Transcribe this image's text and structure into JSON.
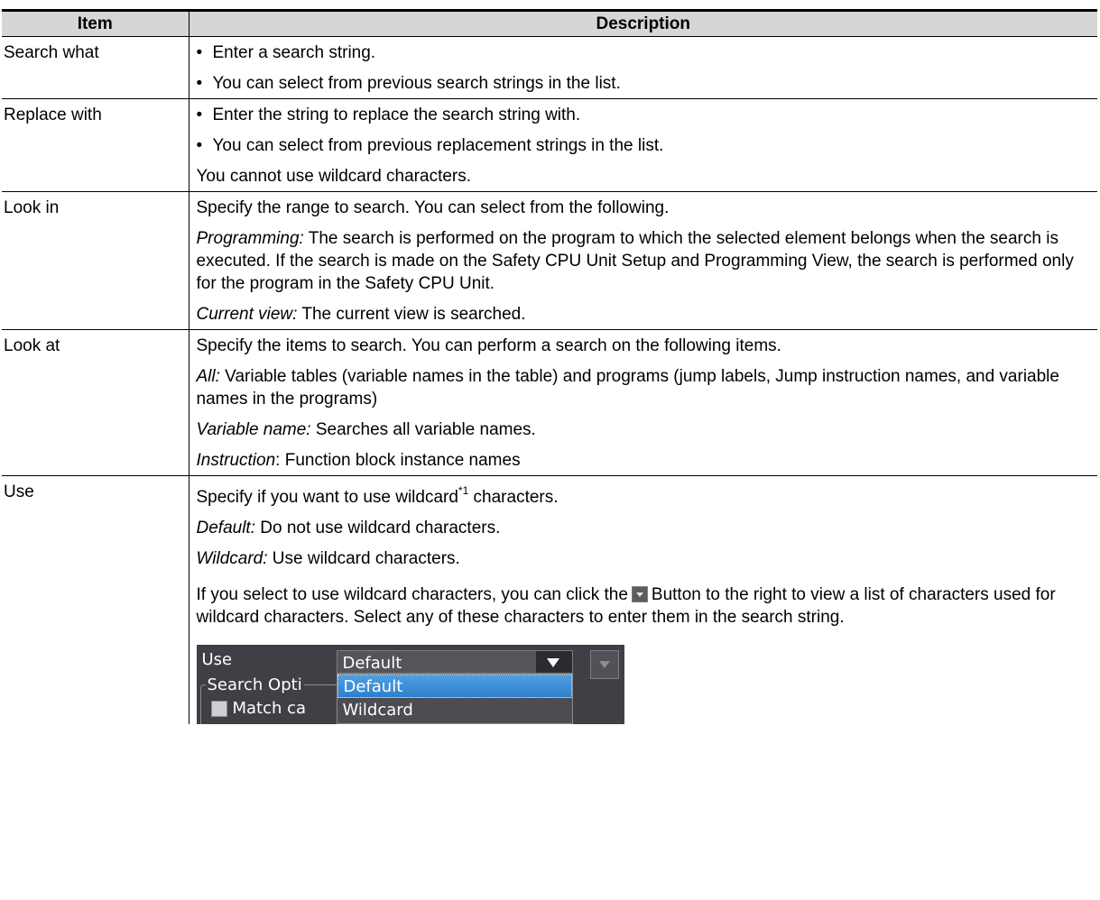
{
  "table": {
    "headers": [
      "Item",
      "Description"
    ],
    "rows": {
      "search_what": {
        "item": "Search what",
        "bullets": [
          "Enter a search string.",
          "You can select from previous search strings in the list."
        ]
      },
      "replace_with": {
        "item": "Replace with",
        "bullets": [
          "Enter the string to replace the search string with.",
          "You can select from previous replacement strings in the list."
        ],
        "note": "You cannot use wildcard characters."
      },
      "look_in": {
        "item": "Look in",
        "intro": "Specify the range to search. You can select from the following.",
        "programming_term": "Programming:",
        "programming_text": " The search is performed on the program to which the selected element belongs when the search is executed. If the search is made on the Safety CPU Unit Setup and Programming View, the search is performed only for the program in the Safety CPU Unit.",
        "current_term": "Current view:",
        "current_text": " The current view is searched."
      },
      "look_at": {
        "item": "Look at",
        "intro": "Specify the items to search. You can perform a search on the following items.",
        "all_term": "All:",
        "all_text": " Variable tables (variable names in the table) and programs (jump labels, Jump instruction names, and variable names in the programs)",
        "varname_term": "Variable name:",
        "varname_text": " Searches all variable names.",
        "instruction_term": "Instruction",
        "instruction_text": ": Function block instance names"
      },
      "use": {
        "item": "Use",
        "intro_before": "Specify if you want to use wildcard",
        "footnote": "*1",
        "intro_after": " characters.",
        "default_term": "Default:",
        "default_text": " Do not use wildcard characters.",
        "wildcard_term": "Wildcard:",
        "wildcard_text": " Use wildcard characters.",
        "hint_before": "If you select to use wildcard characters, you can click the",
        "hint_after": "Button to the right to view a list of characters used for wildcard characters. Select any of these characters to enter them in the search string."
      }
    }
  },
  "screenshot": {
    "use_label": "Use",
    "combo_value": "Default",
    "group_label": "Search Opti",
    "checkbox_label": "Match ca",
    "options": [
      "Default",
      "Wildcard"
    ],
    "selected_option": "Default",
    "colors": {
      "background": "#3e4045",
      "selection": "#3a8ed8"
    }
  },
  "icons": {
    "dropdown_button": "chevron-down-icon"
  }
}
